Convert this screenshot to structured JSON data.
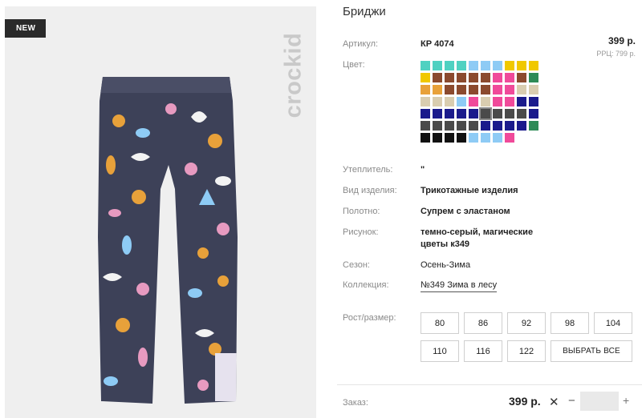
{
  "product": {
    "badge": "NEW",
    "brand": "crockid",
    "title": "Бриджи",
    "price": "399 р.",
    "rrc": "РРЦ: 799 р."
  },
  "specs": {
    "article_label": "Артикул:",
    "article_value": "КР 4074",
    "color_label": "Цвет:",
    "insulation_label": "Утеплитель:",
    "insulation_value": "\"",
    "type_label": "Вид изделия:",
    "type_value": "Трикотажные изделия",
    "fabric_label": "Полотно:",
    "fabric_value": "Супрем с эластаном",
    "pattern_label": "Рисунок:",
    "pattern_value_1": "темно-серый, магические",
    "pattern_value_2": "цветы к349",
    "season_label": "Сезон:",
    "season_value": "Осень-Зима",
    "collection_label": "Коллекция:",
    "collection_value": "№349 Зима в лесу",
    "size_label": "Рост/размер:"
  },
  "swatches": [
    "#4fd1c1",
    "#4fd1c1",
    "#4fd1c1",
    "#4fd1c1",
    "#8ecbf5",
    "#8ecbf5",
    "#8ecbf5",
    "#f0c800",
    "#f0c800",
    "#f0c800",
    "#f0c800",
    "#8b4a2e",
    "#8b4a2e",
    "#8b4a2e",
    "#8b4a2e",
    "#8b4a2e",
    "#f04a9a",
    "#f04a9a",
    "#8b4a2e",
    "#2e8b57",
    "#e8a13a",
    "#e8a13a",
    "#8b4a2e",
    "#8b4a2e",
    "#8b4a2e",
    "#8b4a2e",
    "#f04a9a",
    "#f04a9a",
    "#d9cdb0",
    "#d9cdb0",
    "#d9cdb0",
    "#d9cdb0",
    "#d9cdb0",
    "#8ecbf5",
    "#f04a9a",
    "#d9cdb0",
    "#f04a9a",
    "#f04a9a",
    "#1a1a8c",
    "#1a1a8c",
    "#1a1a8c",
    "#1a1a8c",
    "#1a1a8c",
    "#1a1a8c",
    "#1a1a8c",
    "#4a4a4a",
    "#4a4a4a",
    "#4a4a4a",
    "#4a4a4a",
    "#1a1a8c",
    "#4a4a4a",
    "#4a4a4a",
    "#4a4a4a",
    "#4a4a4a",
    "#4a4a4a",
    "#1a1a8c",
    "#1a1a8c",
    "#1a1a8c",
    "#1a1a8c",
    "#2e8b57",
    "#111111",
    "#111111",
    "#111111",
    "#111111",
    "#8ecbf5",
    "#8ecbf5",
    "#8ecbf5",
    "#f04a9a"
  ],
  "selected_swatch": 45,
  "sizes": [
    "80",
    "86",
    "92",
    "98",
    "104",
    "110",
    "116",
    "122"
  ],
  "select_all": "ВЫБРАТЬ ВСЕ",
  "order": {
    "label": "Заказ:",
    "price": "399 р.",
    "times": "✕",
    "minus": "−",
    "plus": "+",
    "quantity": ""
  }
}
